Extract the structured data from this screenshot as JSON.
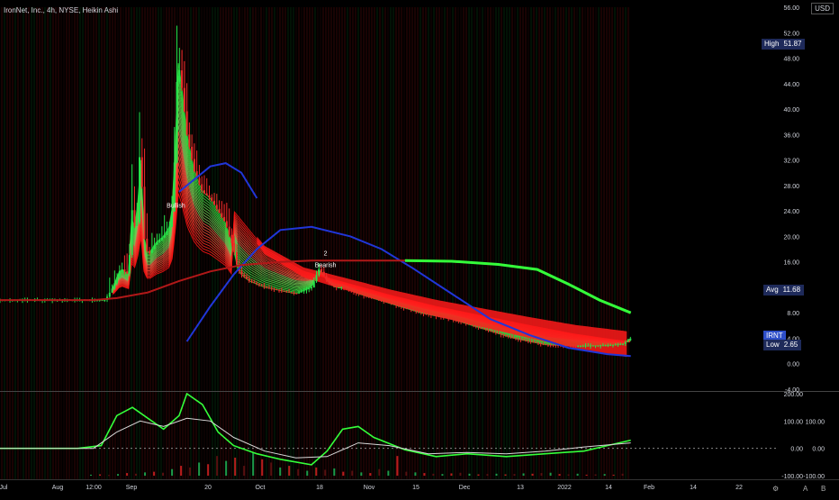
{
  "header": {
    "title": "IronNet, Inc., 4h, NYSE, Heikin Ashi",
    "currency": "USD"
  },
  "price_tags": {
    "high": {
      "label": "High",
      "value": "51.87"
    },
    "avg": {
      "label": "Avg",
      "value": "11.68"
    },
    "symbol": {
      "label": "IRNT",
      "value": ""
    },
    "low": {
      "label": "Low",
      "value": "2.65"
    }
  },
  "annotations": {
    "bullish": "Bullish",
    "bearish_marker": "2",
    "bearish": "Bearish"
  },
  "icons": {
    "settings": "gear-icon",
    "scale_a": "A",
    "scale_b": "B"
  },
  "colors": {
    "up": "#26e34b",
    "down": "#ef2a2a",
    "blue": "#2036d8",
    "green_line": "#34ff3a",
    "darkred": "#b01818",
    "osc_white": "#d8d8d8"
  },
  "chart_data": [
    {
      "type": "line",
      "name": "price-panel",
      "x_ticks": [
        "Jul",
        "Aug",
        "12:00",
        "Sep",
        "20",
        "Oct",
        "18",
        "Nov",
        "15",
        "Dec",
        "13",
        "2022",
        "14",
        "Feb",
        "14",
        "22"
      ],
      "y_ticks": [
        "56.00",
        "52.00",
        "48.00",
        "44.00",
        "40.00",
        "36.00",
        "32.00",
        "28.00",
        "24.00",
        "20.00",
        "16.00",
        "12.00",
        "8.00",
        "4.00",
        "0.00",
        "-4.00"
      ],
      "ylim": [
        -4,
        56
      ],
      "series": [
        {
          "name": "",
          "color": "#2036d8",
          "x": [
            0.24,
            0.27,
            0.3,
            0.33,
            0.36,
            0.4,
            0.45,
            0.49,
            0.53,
            0.58,
            0.63,
            0.68,
            0.73,
            0.78,
            0.81
          ],
          "y": [
            3.5,
            9,
            14,
            18,
            21,
            21.5,
            20,
            18,
            15,
            11,
            7,
            4.5,
            2.5,
            1.5,
            1.2
          ]
        },
        {
          "name": "",
          "color": "#2036d8",
          "x": [
            0.23,
            0.25,
            0.27,
            0.29,
            0.31,
            0.33
          ],
          "y": [
            27,
            29,
            31,
            31.5,
            30,
            26
          ]
        },
        {
          "name": "",
          "color": "#b01818",
          "x": [
            0.0,
            0.12,
            0.15,
            0.19,
            0.23,
            0.27,
            0.31,
            0.36,
            0.4,
            0.45,
            0.52
          ],
          "y": [
            10,
            10,
            10.3,
            11.2,
            13,
            14.5,
            15.5,
            16,
            16.2,
            16.2,
            16.2
          ]
        },
        {
          "name": "",
          "color": "#34ff3a",
          "x": [
            0.52,
            0.58,
            0.64,
            0.69,
            0.73,
            0.77,
            0.81
          ],
          "y": [
            16.2,
            16.1,
            15.6,
            14.8,
            12.5,
            10,
            8
          ]
        },
        {
          "name": "",
          "color": "#ef2a2a",
          "x": [
            0.3,
            0.34,
            0.39,
            0.45,
            0.5,
            0.56,
            0.62,
            0.68,
            0.74,
            0.81
          ],
          "y": [
            24,
            18,
            14.5,
            12.5,
            10.8,
            9,
            7.5,
            6,
            4.6,
            3.4
          ]
        }
      ],
      "price_x": [
        0.0,
        0.12,
        0.135,
        0.145,
        0.155,
        0.165,
        0.17,
        0.175,
        0.18,
        0.185,
        0.19,
        0.2,
        0.21,
        0.22,
        0.225,
        0.228,
        0.233,
        0.24,
        0.25,
        0.26,
        0.27,
        0.28,
        0.29,
        0.3,
        0.305,
        0.31,
        0.32,
        0.34,
        0.36,
        0.38,
        0.4,
        0.41,
        0.42,
        0.43,
        0.44,
        0.46,
        0.5,
        0.54,
        0.58,
        0.62,
        0.66,
        0.7,
        0.74,
        0.78,
        0.8,
        0.81
      ],
      "price_y": [
        10,
        10,
        10,
        12,
        15,
        14,
        25,
        19,
        35,
        20,
        17,
        19,
        20,
        22,
        34,
        48,
        44,
        36,
        30,
        27,
        26,
        24,
        22,
        18,
        15,
        14,
        13,
        12,
        11.5,
        11,
        12,
        15,
        13,
        12,
        12,
        11,
        9.5,
        8,
        7,
        5.5,
        4,
        3,
        2.8,
        2.9,
        3.1,
        4.0
      ]
    },
    {
      "type": "line",
      "name": "oscillator-panel",
      "y_ticks": [
        "200.00",
        "100.00",
        "0.00",
        "-100.00"
      ],
      "ylim": [
        -100,
        200
      ],
      "right_labels": [
        "100.00",
        "0.00",
        "-100.00"
      ],
      "series": [
        {
          "name": "",
          "color": "#34ff3a",
          "x": [
            0.0,
            0.1,
            0.13,
            0.15,
            0.17,
            0.19,
            0.21,
            0.23,
            0.24,
            0.26,
            0.28,
            0.3,
            0.33,
            0.36,
            0.4,
            0.42,
            0.44,
            0.46,
            0.48,
            0.52,
            0.56,
            0.6,
            0.65,
            0.7,
            0.75,
            0.78,
            0.81
          ],
          "y": [
            0,
            0,
            10,
            120,
            150,
            110,
            70,
            120,
            200,
            160,
            60,
            10,
            -20,
            -40,
            -60,
            -10,
            70,
            80,
            40,
            -5,
            -30,
            -20,
            -30,
            -20,
            -10,
            10,
            30
          ]
        },
        {
          "name": "",
          "color": "#d8d8d8",
          "x": [
            0.0,
            0.12,
            0.15,
            0.18,
            0.21,
            0.24,
            0.27,
            0.3,
            0.34,
            0.38,
            0.42,
            0.46,
            0.5,
            0.55,
            0.6,
            0.65,
            0.7,
            0.75,
            0.81
          ],
          "y": [
            0,
            0,
            60,
            100,
            80,
            110,
            100,
            40,
            -10,
            -35,
            -30,
            20,
            10,
            -20,
            -15,
            -20,
            -10,
            5,
            20
          ]
        }
      ],
      "bars": [
        3,
        4,
        2,
        5,
        8,
        6,
        10,
        12,
        9,
        20,
        30,
        25,
        40,
        35,
        60,
        45,
        55,
        30,
        70,
        50,
        40,
        25,
        30,
        20,
        15,
        25,
        18,
        22,
        12,
        15,
        10,
        8,
        20,
        15,
        60,
        12,
        10,
        8,
        6,
        5,
        7,
        9,
        6,
        4,
        5,
        6,
        4,
        5,
        7,
        6,
        8,
        9,
        5,
        4,
        6,
        3,
        4,
        5,
        3,
        6
      ]
    }
  ]
}
